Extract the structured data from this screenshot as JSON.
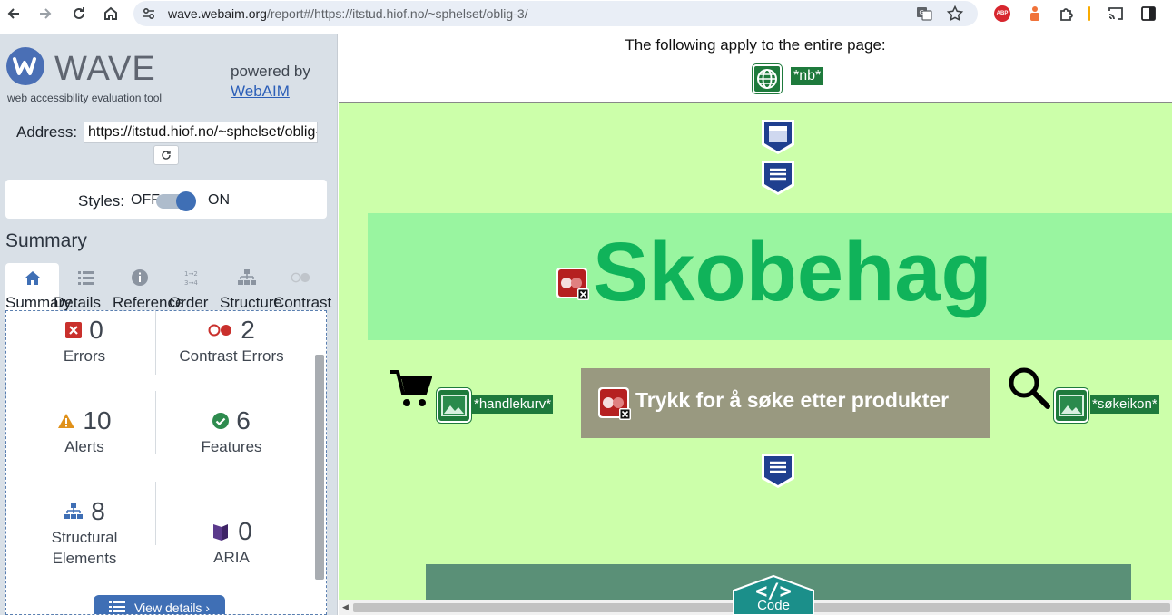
{
  "browser": {
    "url_host": "wave.webaim.org",
    "url_path": "/report#/https://itstud.hiof.no/~sphelset/oblig-3/",
    "extension_abp": "ABP"
  },
  "wave": {
    "brand": "WAVE",
    "tagline": "web accessibility evaluation tool",
    "powered_by": "powered by",
    "webaim_link": "WebAIM",
    "address_label": "Address:",
    "address_value": "https://itstud.hiof.no/~sphelset/oblig-3/",
    "styles_label": "Styles:",
    "styles_off": "OFF",
    "styles_on": "ON",
    "styles_enabled": true,
    "summary_heading": "Summary",
    "tabs": [
      {
        "label": "Summary",
        "icon": "home-icon",
        "active": true
      },
      {
        "label": "Details",
        "icon": "list-icon",
        "active": false
      },
      {
        "label": "Reference",
        "icon": "info-icon",
        "active": false
      },
      {
        "label": "Order",
        "icon": "order-icon",
        "active": false
      },
      {
        "label": "Structure",
        "icon": "structure-icon",
        "active": false
      },
      {
        "label": "Contrast",
        "icon": "contrast-icon",
        "active": false
      }
    ],
    "stats": {
      "errors": {
        "count": "0",
        "label": "Errors",
        "color": "#c9302c"
      },
      "contrast_errors": {
        "count": "2",
        "label": "Contrast Errors",
        "color": "#c9302c"
      },
      "alerts": {
        "count": "10",
        "label": "Alerts",
        "color": "#e0911a"
      },
      "features": {
        "count": "6",
        "label": "Features",
        "color": "#2e8b4e"
      },
      "structural": {
        "count": "8",
        "label_line1": "Structural",
        "label_line2": "Elements",
        "color": "#3f6fb5"
      },
      "aria": {
        "count": "0",
        "label": "ARIA",
        "color": "#5b3a8c"
      }
    },
    "view_details_label": "View details ›"
  },
  "page": {
    "header_text": "The following apply to the entire page:",
    "lang_label": "*nb*",
    "site_title": "Skobehag",
    "cart_alt": "*handlekurv*",
    "search_button_text": "Trykk for å søke etter produkter",
    "search_icon_alt": "*søkeikon*",
    "code_tab_label": "Code"
  }
}
